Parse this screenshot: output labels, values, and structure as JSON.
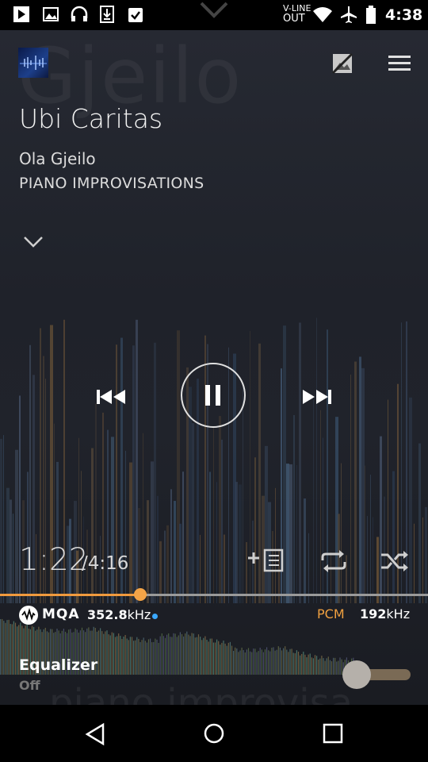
{
  "status_bar": {
    "line_out_top": "V-LINE",
    "line_out_bottom": "OUT",
    "time": "4:38",
    "icons": [
      "play-store-icon",
      "image-icon",
      "headphones-icon",
      "download-icon",
      "clipboard-check-icon",
      "wifi-icon",
      "airplane-icon",
      "battery-icon"
    ]
  },
  "background": {
    "word_top": "Gjeilo",
    "word_bottom": "piano improvisa"
  },
  "track": {
    "title": "Ubi Caritas",
    "artist": "Ola Gjeilo",
    "album": "PIANO IMPROVISATIONS"
  },
  "playback": {
    "elapsed": "1:22",
    "total": "/4:16",
    "progress_fraction": 0.328,
    "state": "playing"
  },
  "format": {
    "mqa_label": "MQA",
    "mqa_rate_value": "352.8",
    "mqa_rate_unit": "kHz",
    "pcm_label": "PCM",
    "pcm_rate_value": "192",
    "pcm_rate_unit": "kHz"
  },
  "equalizer": {
    "label": "Equalizer",
    "state": "Off",
    "enabled": false
  },
  "colors": {
    "accent": "#f09a3e",
    "mqa_dot": "#3aa8ff"
  }
}
